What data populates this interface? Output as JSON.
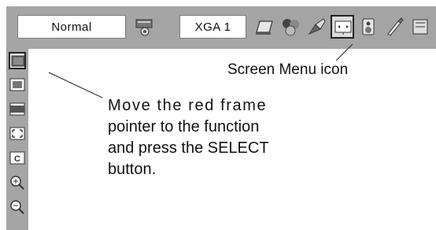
{
  "topbar": {
    "mode_label": "Normal",
    "resolution_label": "XGA 1",
    "icons": [
      "input-select-icon",
      "pc-adjust-icon",
      "image-select-icon",
      "image-adjust-icon",
      "screen-icon",
      "sound-icon",
      "setting-icon",
      "information-icon"
    ],
    "selected_icon": "screen-icon"
  },
  "sidebar": {
    "icons": [
      "normal-icon",
      "true-icon",
      "wide-icon",
      "full-icon",
      "custom-icon",
      "digital-zoom-plus-icon",
      "digital-zoom-minus-icon"
    ],
    "selected_icon": "normal-icon"
  },
  "callouts": {
    "screen_menu_icon": "Screen Menu icon",
    "instruction_lines": [
      "Move the red frame",
      "pointer to the function",
      "and press the SELECT",
      "button."
    ]
  }
}
